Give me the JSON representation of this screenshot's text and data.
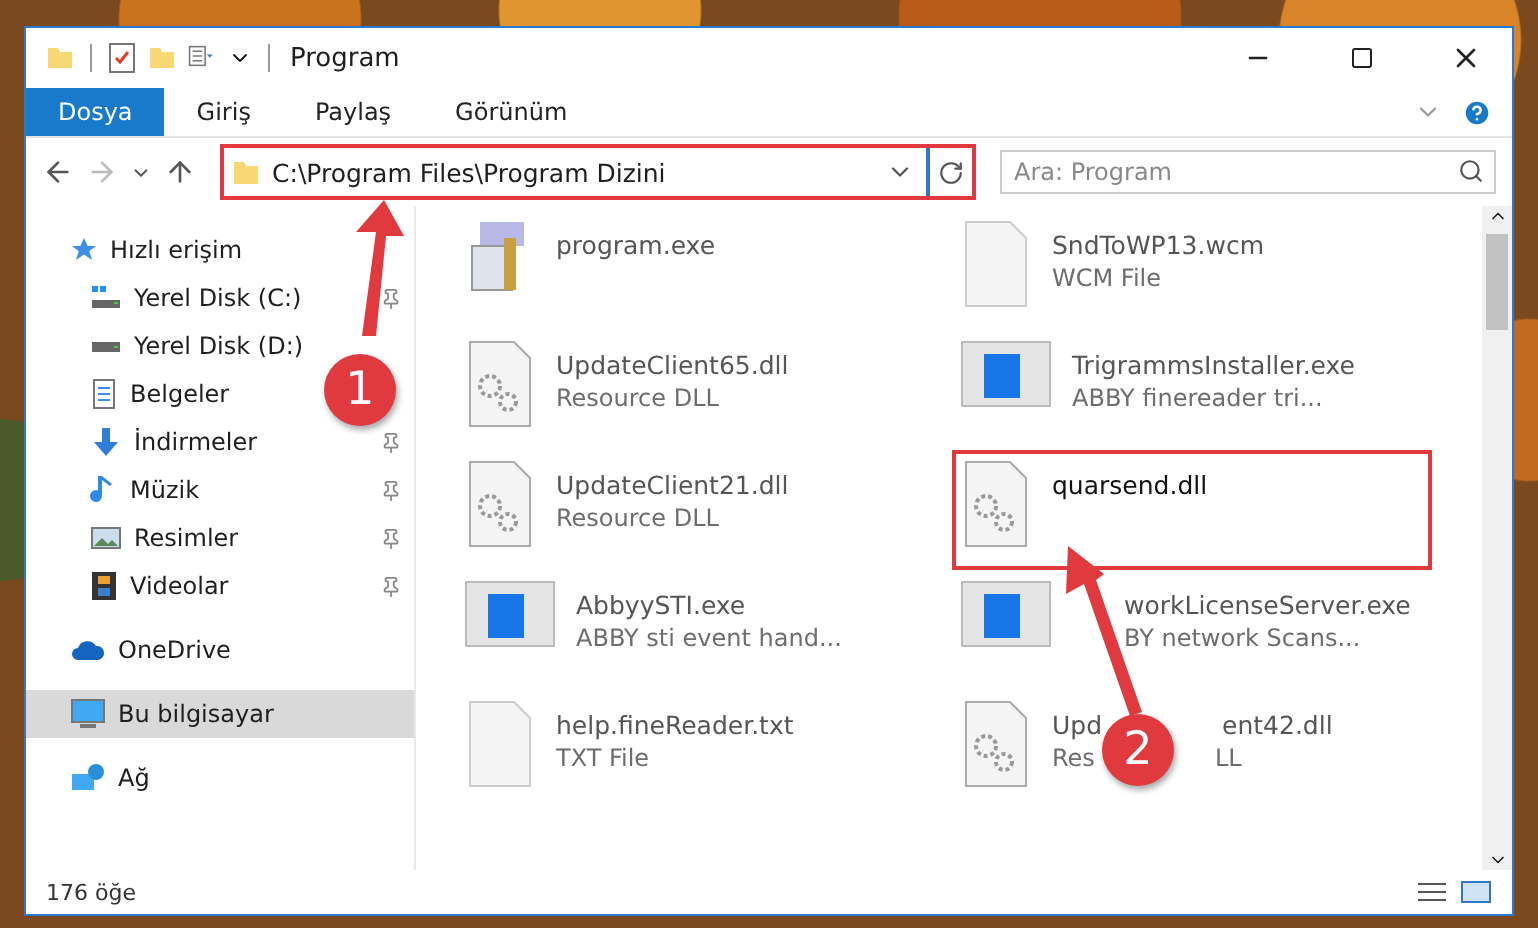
{
  "window": {
    "title": "Program"
  },
  "ribbon_tabs": [
    {
      "label": "Dosya",
      "selected": true
    },
    {
      "label": "Giriş",
      "selected": false
    },
    {
      "label": "Paylaş",
      "selected": false
    },
    {
      "label": "Görünüm",
      "selected": false
    }
  ],
  "address": {
    "path": "C:\\Program Files\\Program Dizini",
    "highlighted": true
  },
  "search": {
    "placeholder": "Ara: Program"
  },
  "sidebar": {
    "items": [
      {
        "label": "Hızlı erişim",
        "selected": false,
        "children": [
          {
            "label": "Yerel Disk (C:)",
            "pinned": true,
            "selected": false
          },
          {
            "label": "Yerel Disk (D:)",
            "pinned": false,
            "selected": false
          },
          {
            "label": "Belgeler",
            "pinned": false,
            "selected": false
          },
          {
            "label": "İndirmeler",
            "pinned": true,
            "selected": false
          },
          {
            "label": "Müzik",
            "pinned": true,
            "selected": false
          },
          {
            "label": "Resimler",
            "pinned": true,
            "selected": false
          },
          {
            "label": "Videolar",
            "pinned": true,
            "selected": false
          }
        ]
      },
      {
        "label": "OneDrive",
        "selected": false
      },
      {
        "label": "Bu bilgisayar",
        "selected": true
      },
      {
        "label": "Ağ",
        "selected": false
      }
    ]
  },
  "files": [
    {
      "name": "program.exe",
      "kind": "app",
      "highlighted": false
    },
    {
      "name": "SndToWP13.wcm",
      "type": "WCM File",
      "kind": "blank",
      "highlighted": false
    },
    {
      "name": "UpdateClient65.dll",
      "type": "Resource DLL",
      "kind": "dll",
      "highlighted": false
    },
    {
      "name": "TrigrammsInstaller.exe",
      "type": "ABBY finereader tri...",
      "kind": "window",
      "highlighted": false
    },
    {
      "name": "UpdateClient21.dll",
      "type": "Resource DLL",
      "kind": "dll",
      "highlighted": false
    },
    {
      "name": "quarsend.dll",
      "kind": "dll",
      "highlighted": true
    },
    {
      "name": "AbbyySTI.exe",
      "type": "ABBY sti event hand...",
      "kind": "window",
      "highlighted": false
    },
    {
      "name": "workLicenseServer.exe",
      "type": "BY network Scans...",
      "kind": "window",
      "highlighted": false
    },
    {
      "name": "help.fineReader.txt",
      "type": "TXT File",
      "kind": "blank",
      "highlighted": false
    },
    {
      "name": "Upd",
      "name_tail": "ent42.dll",
      "type": "Res",
      "type_tail": "LL",
      "kind": "dll",
      "highlighted": false
    }
  ],
  "status_bar": {
    "count": "176 öğe"
  },
  "annotations": [
    {
      "label": "1"
    },
    {
      "label": "2"
    }
  ]
}
